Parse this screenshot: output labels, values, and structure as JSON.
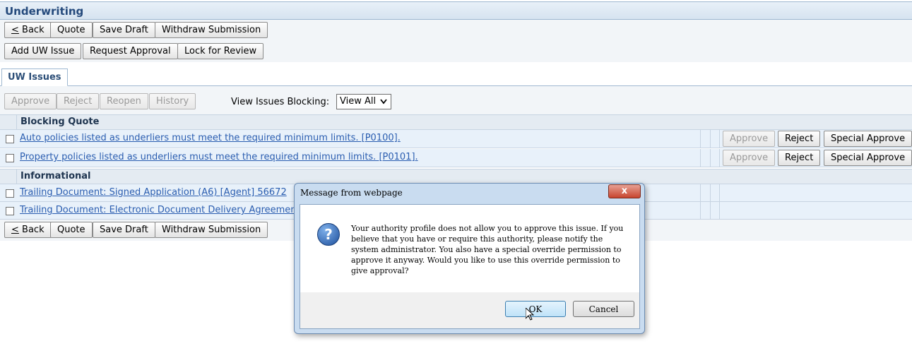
{
  "header": {
    "title": "Underwriting"
  },
  "nav_buttons": {
    "back_prefix": "<",
    "back_label": " Back",
    "quote_label": "Quote",
    "save_draft_label": "Save Draft",
    "withdraw_label": "Withdraw Submission"
  },
  "action_buttons": {
    "add_uw_issue": "Add UW Issue",
    "request_approval": "Request Approval",
    "lock_for_review": "Lock for Review"
  },
  "tabs": [
    {
      "label": "UW Issues"
    }
  ],
  "issues_toolbar": {
    "approve": "Approve",
    "reject": "Reject",
    "reopen": "Reopen",
    "history": "History",
    "view_label": "View Issues Blocking:",
    "view_value": "View All"
  },
  "groups": [
    {
      "title": "Blocking Quote",
      "issues": [
        {
          "text": "Auto policies listed as underliers must meet the required minimum limits. [P0100].",
          "approve": "Approve",
          "reject": "Reject",
          "special": "Special Approve"
        },
        {
          "text": "Property policies listed as underliers must meet the required minimum limits. [P0101].",
          "approve": "Approve",
          "reject": "Reject",
          "special": "Special Approve"
        }
      ]
    },
    {
      "title": "Informational",
      "issues": [
        {
          "text": "Trailing Document: Signed Application (A6) [Agent] 56672"
        },
        {
          "text": "Trailing Document: Electronic Document Delivery Agreemen"
        }
      ]
    }
  ],
  "dialog": {
    "title": "Message from webpage",
    "close_glyph": "x",
    "icon_glyph": "?",
    "message": "Your authority profile does not allow you to approve this issue. If you believe that you have or require this authority, please notify the system administrator. You also have a special override permission to approve it anyway. Would you like to use this override permission to give approval?",
    "ok_label": "OK",
    "cancel_label": "Cancel"
  },
  "colors": {
    "link": "#2a5db0",
    "header_text": "#254a7c",
    "row_background": "#e8f1fa",
    "close_button": "#c7452f"
  },
  "icons": [
    "question-icon",
    "close-icon",
    "chevron-down-icon",
    "mouse-cursor-icon"
  ]
}
